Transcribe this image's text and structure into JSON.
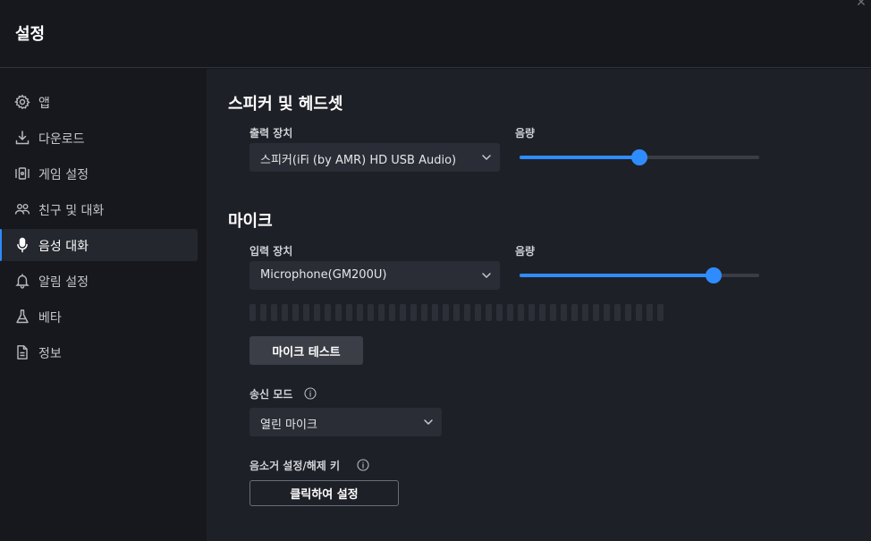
{
  "header": {
    "title": "설정"
  },
  "sidebar": {
    "items": [
      {
        "label": "앱",
        "icon": "gear-icon",
        "active": false
      },
      {
        "label": "다운로드",
        "icon": "download-icon",
        "active": false
      },
      {
        "label": "게임 설정",
        "icon": "game-settings-icon",
        "active": false
      },
      {
        "label": "친구 및 대화",
        "icon": "friends-icon",
        "active": false
      },
      {
        "label": "음성 대화",
        "icon": "microphone-icon",
        "active": true
      },
      {
        "label": "알림 설정",
        "icon": "bell-icon",
        "active": false
      },
      {
        "label": "베타",
        "icon": "flask-icon",
        "active": false
      },
      {
        "label": "정보",
        "icon": "document-icon",
        "active": false
      }
    ]
  },
  "speaker": {
    "title": "스피커 및 헤드셋",
    "device_label": "출력 장치",
    "device_value": "스피커(iFi (by AMR) HD USB Audio)",
    "volume_label": "음량",
    "volume": 0.5
  },
  "mic": {
    "title": "마이크",
    "device_label": "입력 장치",
    "device_value": "Microphone(GM200U)",
    "volume_label": "음량",
    "volume": 0.81,
    "meter_segments": 39,
    "meter_level": 0,
    "test_button": "마이크 테스트",
    "mode_label": "송신 모드",
    "mode_value": "열린 마이크",
    "mute_key_label": "음소거 설정/해제 키",
    "mute_key_button": "클릭하여 설정"
  },
  "colors": {
    "accent": "#2f8cff",
    "background": "#1e2027",
    "sidebar": "#16181d"
  }
}
